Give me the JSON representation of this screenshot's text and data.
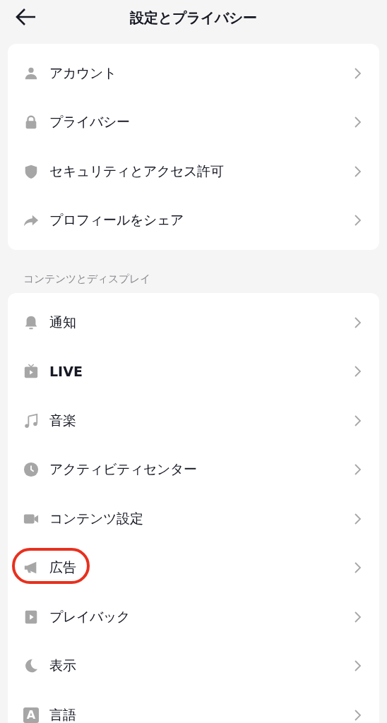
{
  "header": {
    "title": "設定とプライバシー"
  },
  "sections": [
    {
      "items": [
        {
          "kind": "person",
          "label": "アカウント",
          "bold": false,
          "highlighted": false
        },
        {
          "kind": "lock",
          "label": "プライバシー",
          "bold": false,
          "highlighted": false
        },
        {
          "kind": "shield",
          "label": "セキュリティとアクセス許可",
          "bold": false,
          "highlighted": false
        },
        {
          "kind": "share",
          "label": "プロフィールをシェア",
          "bold": false,
          "highlighted": false
        }
      ]
    },
    {
      "heading": "コンテンツとディスプレイ",
      "items": [
        {
          "kind": "bell",
          "label": "通知",
          "bold": false,
          "highlighted": false
        },
        {
          "kind": "tv",
          "label": "LIVE",
          "bold": true,
          "highlighted": false
        },
        {
          "kind": "music",
          "label": "音楽",
          "bold": false,
          "highlighted": false
        },
        {
          "kind": "clock",
          "label": "アクティビティセンター",
          "bold": false,
          "highlighted": false
        },
        {
          "kind": "camera",
          "label": "コンテンツ設定",
          "bold": false,
          "highlighted": false
        },
        {
          "kind": "megaphone",
          "label": "広告",
          "bold": false,
          "highlighted": true
        },
        {
          "kind": "play",
          "label": "プレイバック",
          "bold": false,
          "highlighted": false
        },
        {
          "kind": "moon",
          "label": "表示",
          "bold": false,
          "highlighted": false
        },
        {
          "kind": "letter",
          "icon_label": "A",
          "label": "言語",
          "bold": false,
          "highlighted": false
        }
      ]
    }
  ]
}
